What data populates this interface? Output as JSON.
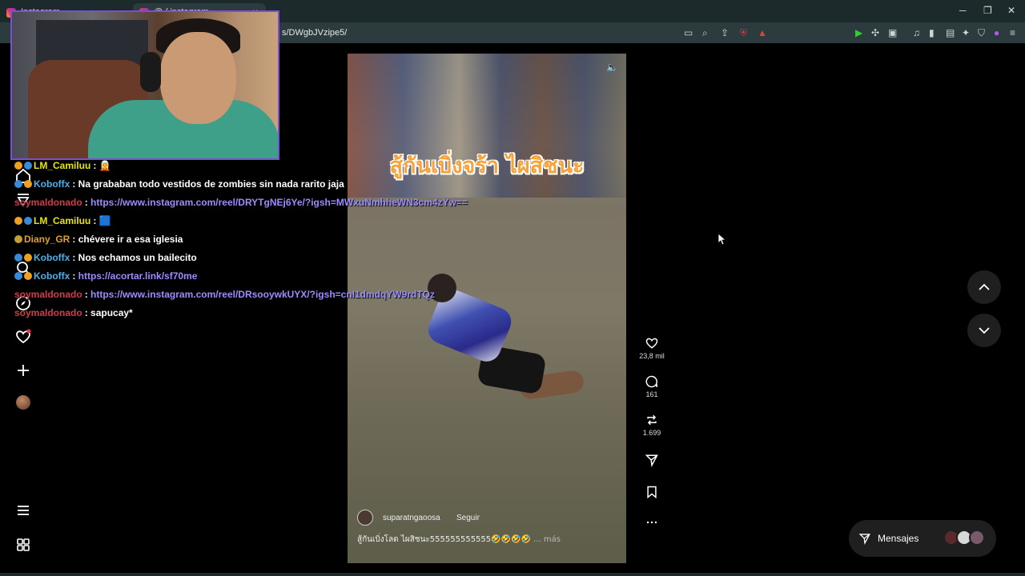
{
  "browser": {
    "tab1_title": "Instagram",
    "tab2_title": "@ / instagram",
    "url": "s/DWgbJVzipe5/",
    "minimize": "─",
    "restore": "❐",
    "close": "✕"
  },
  "reel": {
    "caption_overlay": "สู้กันเบิ่งจร้า ไผสิชนะ",
    "username": "suparatngaoosa",
    "follow_label": "Seguir",
    "description": "สู้กันเบิ่งโลด ไผสิชนะ555555555555🤣🤣🤣🤣",
    "more_label": "... más",
    "likes": "23,8 mil",
    "comments": "161",
    "reposts": "1.699"
  },
  "messages": {
    "label": "Mensajes"
  },
  "chat": [
    {
      "user": "LM_Camiluu",
      "user_color": "#e6e600",
      "text": " 🧝",
      "link": "",
      "badges": [
        "#f0a020",
        "#3a8ad8"
      ]
    },
    {
      "user": "Koboffx",
      "user_color": "#4fb0e8",
      "text": "Na grababan todo vestidos de zombies sin nada rarito jaja",
      "link": "",
      "badges": [
        "#3a8ad8",
        "#f0a020"
      ]
    },
    {
      "user": "soymaldonado",
      "user_color": "#d23c4a",
      "text": "",
      "link": "https://www.instagram.com/reel/DRYTgNEj6Ye/?igsh=MWxuNmhheWN3cm4zYw==",
      "badges": []
    },
    {
      "user": "LM_Camiluu",
      "user_color": "#e6e600",
      "text": " 🟦",
      "link": "",
      "badges": [
        "#f0a020",
        "#3a8ad8"
      ]
    },
    {
      "user": "Diany_GR",
      "user_color": "#e0a030",
      "text": "chévere ir a esa iglesia",
      "link": "",
      "badges": [
        "#c0a030"
      ]
    },
    {
      "user": "Koboffx",
      "user_color": "#4fb0e8",
      "text": "Nos echamos un bailecito",
      "link": "",
      "badges": [
        "#3a8ad8",
        "#f0a020"
      ]
    },
    {
      "user": "Koboffx",
      "user_color": "#4fb0e8",
      "text": "",
      "link": "https://acortar.link/sf70me",
      "badges": [
        "#3a8ad8",
        "#f0a020"
      ]
    },
    {
      "user": "soymaldonado",
      "user_color": "#d23c4a",
      "text": "",
      "link": "https://www.instagram.com/reel/DRsooywkUYX/?igsh=cnI1dmdqYW9rdTQz",
      "badges": []
    },
    {
      "user": "soymaldonado",
      "user_color": "#d23c4a",
      "text": "sapucay*",
      "link": "",
      "badges": []
    }
  ],
  "colors": {
    "accent_purple": "#7b4dd8",
    "link": "#9b8cff",
    "caption_orange": "#f7a23a"
  },
  "icons": {
    "home": "home-icon",
    "search": "search-icon",
    "explore": "compass-icon",
    "reels": "reels-icon",
    "notifications": "heart-icon",
    "create": "plus-icon",
    "menu": "hamburger-icon",
    "more_apps": "grid-icon"
  }
}
